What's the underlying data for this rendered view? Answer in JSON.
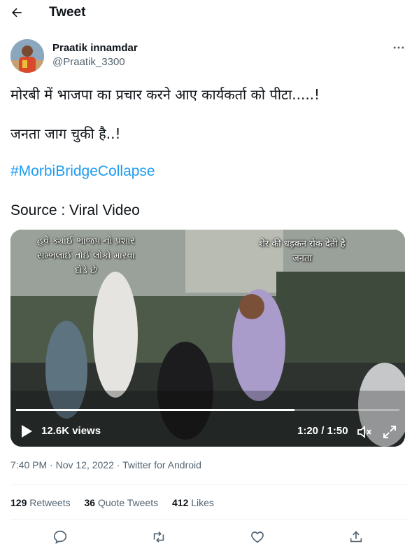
{
  "header": {
    "title": "Tweet",
    "back_icon": "arrow-left-icon"
  },
  "author": {
    "name": "Praatik innamdar",
    "handle": "@Praatik_3300"
  },
  "tweet": {
    "line1": "मोरबी में भाजपा का प्रचार करने आए कार्यकर्ता को पीटा.....!",
    "line2": "जनता जाग चुकी है..!",
    "hashtag": "#MorbiBridgeCollapse",
    "line4": "Source : Viral Video"
  },
  "video": {
    "overlay_left": "હવે ક્યાંઈ ભાજપ નો પ્રશાર\nસમ્ભલાઈ તોઈ લોકો મારવા\nદોડે છે",
    "overlay_right": "शेर की धड़कन रोक देती है\nजनता",
    "views": "12.6K views",
    "time": "1:20 / 1:50",
    "progress": 0.727
  },
  "meta": {
    "time": "7:40 PM",
    "date": "Nov 12, 2022",
    "source": "Twitter for Android",
    "separator": "·"
  },
  "stats": {
    "retweets_count": "129",
    "retweets_label": "Retweets",
    "quotes_count": "36",
    "quotes_label": "Quote Tweets",
    "likes_count": "412",
    "likes_label": "Likes"
  },
  "colors": {
    "link": "#1d9bf0",
    "secondary": "#536471",
    "divider": "#eff3f4"
  }
}
